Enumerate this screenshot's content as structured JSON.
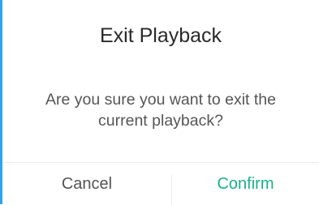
{
  "dialog": {
    "title": "Exit Playback",
    "message": "Are you sure you want to exit the current playback?",
    "cancel_label": "Cancel",
    "confirm_label": "Confirm"
  },
  "colors": {
    "accent_border": "#2ea3f2",
    "confirm_text": "#19b08e",
    "title_text": "#2a2a2a",
    "body_text": "#555555"
  }
}
